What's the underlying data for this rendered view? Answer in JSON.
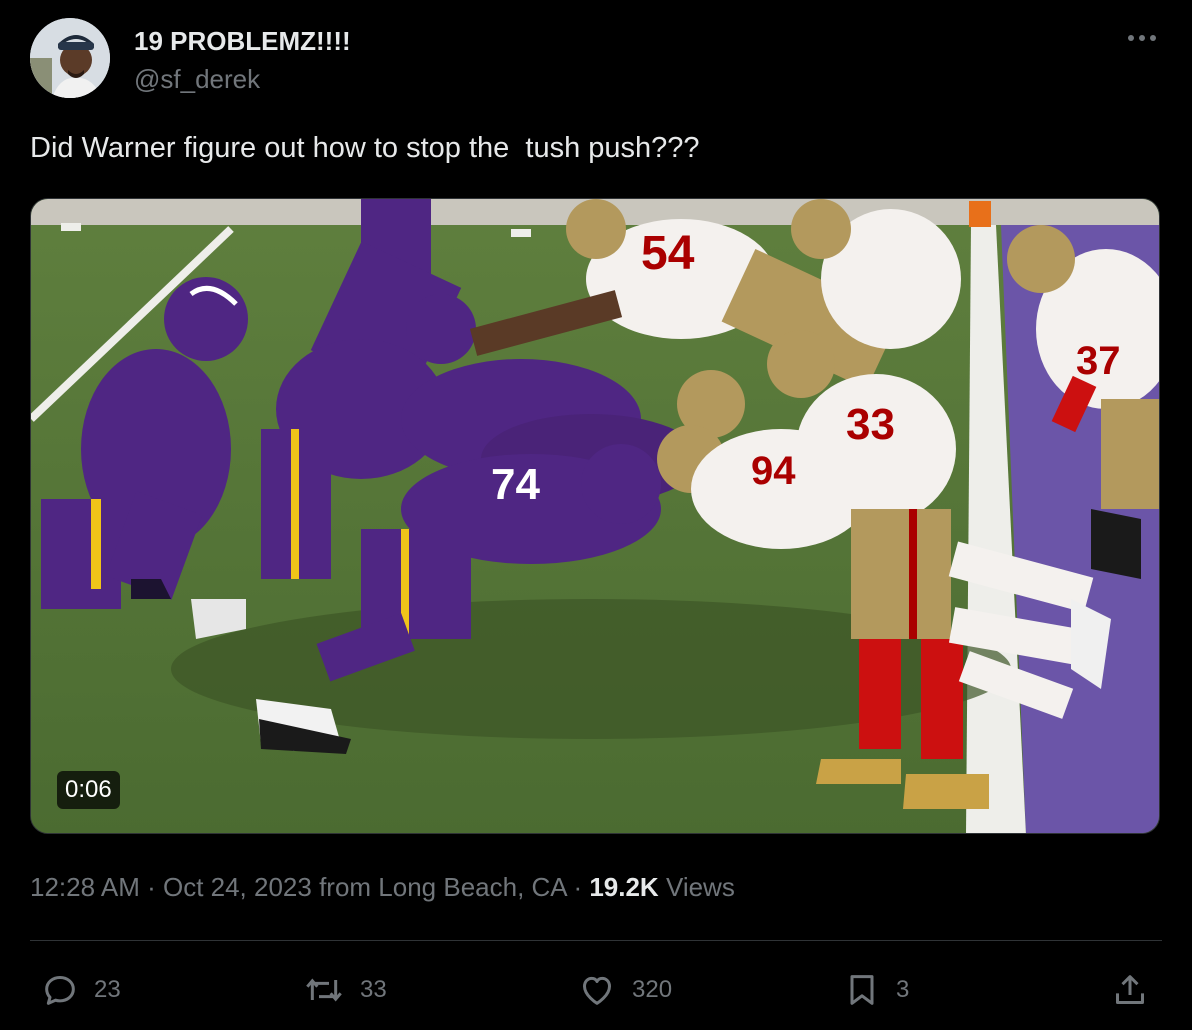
{
  "author": {
    "display_name": "19 PROBLEMZ!!!!",
    "handle": "@sf_derek",
    "avatar_icon": "avatar"
  },
  "more_icon": "more-dots-icon",
  "tweet": {
    "text": "Did Warner figure out how to stop the  tush push???"
  },
  "media": {
    "type": "video",
    "duration": "0:06",
    "colors": {
      "field": "#4a6a34",
      "vikings_purple": "#4f2683",
      "niners_white": "#f4f1ee",
      "niners_red": "#aa0000",
      "niners_gold": "#b3995d",
      "endzone": "#6b55a8"
    }
  },
  "meta": {
    "time": "12:28 AM",
    "separator": " · ",
    "date": "Oct 24, 2023 from Long Beach, CA",
    "views_count": "19.2K",
    "views_label": " Views"
  },
  "actions": {
    "replies": "23",
    "reposts": "33",
    "likes": "320",
    "bookmarks": "3"
  },
  "colors": {
    "background": "#000000",
    "primary_text": "#e7e9ea",
    "secondary_text": "#71767b",
    "divider": "#2f3336"
  }
}
